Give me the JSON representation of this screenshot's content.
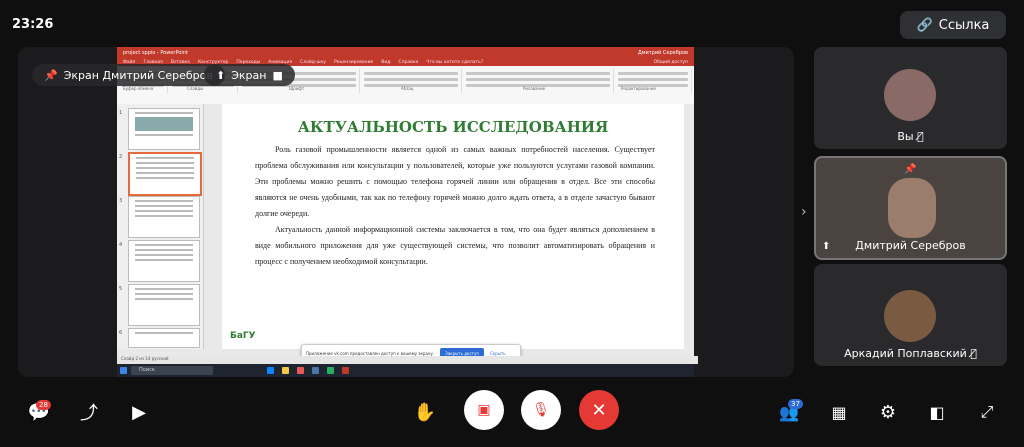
{
  "header": {
    "time": "23:26",
    "link_label": "Ссылка"
  },
  "stage": {
    "pin_label": "Экран Дмитрий Серебров",
    "screen_label": "Экран"
  },
  "ppt": {
    "title": "project sppio - PowerPoint",
    "user": "Дмитрий Серебров",
    "tabs": [
      "Файл",
      "Главная",
      "Вставка",
      "Конструктор",
      "Переходы",
      "Анимация",
      "Слайд-шоу",
      "Рецензирование",
      "Вид",
      "Справка",
      "Что вы хотите сделать?"
    ],
    "share": "Общий доступ",
    "ribbon_groups": [
      "Буфер обмена",
      "Слайды",
      "Шрифт",
      "Абзац",
      "Рисование",
      "Редактирование"
    ],
    "slide_title": "АКТУАЛЬНОСТЬ ИССЛЕДОВАНИЯ",
    "paragraph1": "Роль газовой промышленности является одной из самых важных потребностей населения. Существует проблема обслуживания или консультации у пользователей, которые уже пользуются услугами газовой компании. Эти проблемы можно решить с помощью телефона горячей линии или обращения в отдел. Все эти способы являются не очень удобными, так как по телефону горячей можно долго ждать ответа, а в отделе зачастую бывают долгие очереди.",
    "paragraph2": "Актуальность данной информационной системы заключается в том, что она будет являться дополнением в виде мобильного приложения для уже существующей системы, что позволит автоматизировать обращения и процесс с получением необходимой консультации.",
    "logo": "БаГУ",
    "notification_text": "Приложение vk.com предоставлен доступ к вашему экрану.",
    "notification_button": "Закрыть доступ",
    "notification_hide": "Скрыть",
    "status_text": "Слайд 2 из 14   русский",
    "taskbar_search": "Поиск",
    "thumbnails": [
      "1",
      "2",
      "3",
      "4",
      "5",
      "6"
    ]
  },
  "participants": [
    {
      "name": "Вы",
      "muted": true
    },
    {
      "name": "Дмитрий Серебров",
      "muted": false
    },
    {
      "name": "Аркадий Поплавский",
      "muted": true
    }
  ],
  "toolbar": {
    "chat_badge": "28",
    "participants_badge": "37"
  },
  "colors": {
    "end_call": "#e53935",
    "accent": "#2c6bd6",
    "ppt_red": "#c0392b"
  }
}
